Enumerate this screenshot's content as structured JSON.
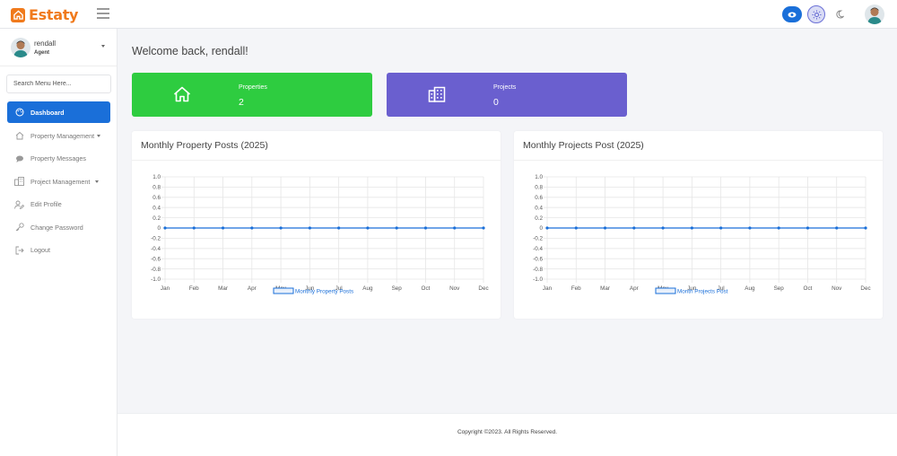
{
  "brand": {
    "name": "Estaty",
    "color": "#f07a1c"
  },
  "header": {
    "actions": [
      {
        "name": "eye-toggle",
        "icon": "eye-icon"
      },
      {
        "name": "theme-light",
        "icon": "sun-icon"
      },
      {
        "name": "theme-dark",
        "icon": "moon-icon"
      }
    ]
  },
  "sidebar": {
    "user": {
      "name": "rendall",
      "role": "Agent"
    },
    "search": {
      "placeholder": "Search Menu Here..."
    },
    "items": [
      {
        "label": "Dashboard",
        "icon": "palette-icon",
        "active": true
      },
      {
        "label": "Property Management",
        "icon": "home-icon",
        "dropdown": true
      },
      {
        "label": "Property Messages",
        "icon": "chat-icon"
      },
      {
        "label": "Project Management",
        "icon": "buildings-icon",
        "dropdown": true
      },
      {
        "label": "Edit Profile",
        "icon": "user-edit-icon"
      },
      {
        "label": "Change Password",
        "icon": "key-icon"
      },
      {
        "label": "Logout",
        "icon": "logout-icon"
      }
    ]
  },
  "main": {
    "welcome": "Welcome back, rendall!",
    "stats": [
      {
        "label": "Properties",
        "value": "2",
        "color": "#2ecc40",
        "icon": "home-icon"
      },
      {
        "label": "Projects",
        "value": "0",
        "color": "#6a5fcf",
        "icon": "building-icon"
      }
    ],
    "charts": [
      {
        "title": "Monthly Property Posts (2025)"
      },
      {
        "title": "Monthly Projects Post (2025)"
      }
    ]
  },
  "chart_data": [
    {
      "type": "line",
      "title": "Monthly Property Posts (2025)",
      "categories": [
        "Jan",
        "Feb",
        "Mar",
        "Apr",
        "May",
        "Jun",
        "Jul",
        "Aug",
        "Sep",
        "Oct",
        "Nov",
        "Dec"
      ],
      "series": [
        {
          "name": "Monthly Property Posts",
          "values": [
            0,
            0,
            0,
            0,
            0,
            0,
            0,
            0,
            0,
            0,
            0,
            0
          ]
        }
      ],
      "yticks": [
        "1.0",
        "0.8",
        "0.6",
        "0.4",
        "0.2",
        "0",
        "-0.2",
        "-0.4",
        "-0.6",
        "-0.8",
        "-1.0"
      ],
      "ylim": [
        -1,
        1
      ],
      "grid": true,
      "legend": "bottom",
      "color": "#1a6fd9"
    },
    {
      "type": "line",
      "title": "Monthly Projects Post (2025)",
      "categories": [
        "Jan",
        "Feb",
        "Mar",
        "Apr",
        "May",
        "Jun",
        "Jul",
        "Aug",
        "Sep",
        "Oct",
        "Nov",
        "Dec"
      ],
      "series": [
        {
          "name": "Month Projects Post",
          "values": [
            0,
            0,
            0,
            0,
            0,
            0,
            0,
            0,
            0,
            0,
            0,
            0
          ]
        }
      ],
      "yticks": [
        "1.0",
        "0.8",
        "0.6",
        "0.4",
        "0.2",
        "0",
        "-0.2",
        "-0.4",
        "-0.6",
        "-0.8",
        "-1.0"
      ],
      "ylim": [
        -1,
        1
      ],
      "grid": true,
      "legend": "bottom",
      "color": "#1a6fd9"
    }
  ],
  "footer": {
    "text": "Copyright ©2023. All Rights Reserved."
  }
}
